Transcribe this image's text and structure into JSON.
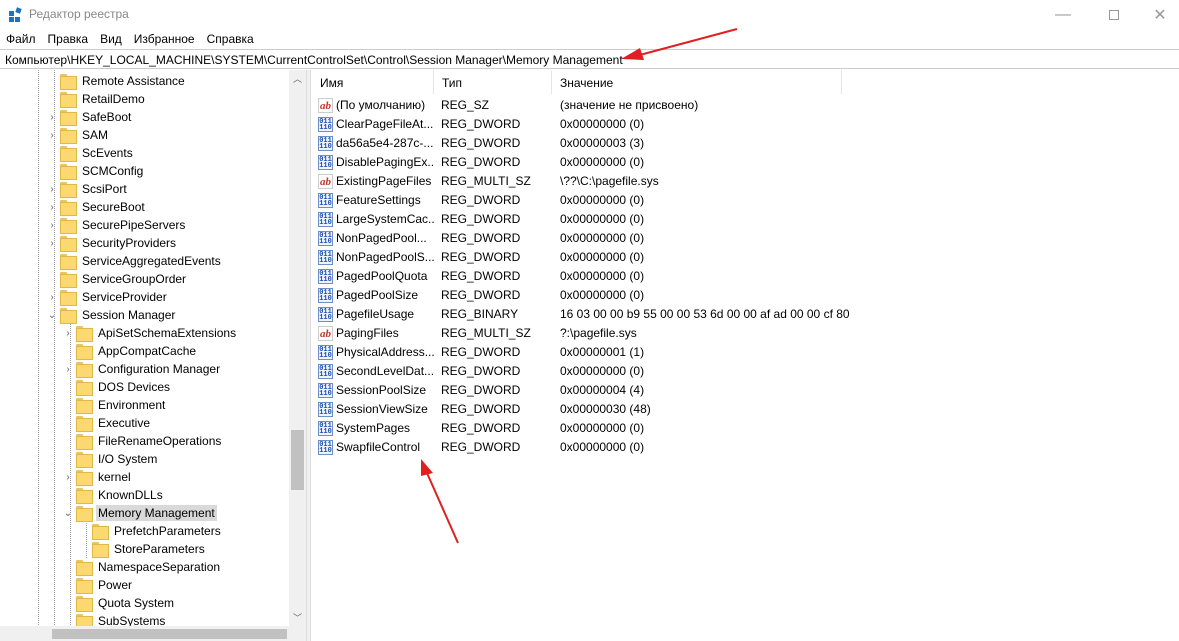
{
  "window": {
    "title": "Редактор реестра",
    "minimize_icon": "minimize-icon",
    "maximize_icon": "maximize-icon",
    "close_icon": "close-icon"
  },
  "menu": [
    "Файл",
    "Правка",
    "Вид",
    "Избранное",
    "Справка"
  ],
  "address": "Компьютер\\HKEY_LOCAL_MACHINE\\SYSTEM\\CurrentControlSet\\Control\\Session Manager\\Memory Management",
  "tree": {
    "items": [
      {
        "label": "Remote Assistance",
        "level": 1,
        "expander": ""
      },
      {
        "label": "RetailDemo",
        "level": 1,
        "expander": ""
      },
      {
        "label": "SafeBoot",
        "level": 1,
        "expander": "›"
      },
      {
        "label": "SAM",
        "level": 1,
        "expander": "›"
      },
      {
        "label": "ScEvents",
        "level": 1,
        "expander": ""
      },
      {
        "label": "SCMConfig",
        "level": 1,
        "expander": ""
      },
      {
        "label": "ScsiPort",
        "level": 1,
        "expander": "›"
      },
      {
        "label": "SecureBoot",
        "level": 1,
        "expander": "›"
      },
      {
        "label": "SecurePipeServers",
        "level": 1,
        "expander": "›"
      },
      {
        "label": "SecurityProviders",
        "level": 1,
        "expander": "›"
      },
      {
        "label": "ServiceAggregatedEvents",
        "level": 1,
        "expander": ""
      },
      {
        "label": "ServiceGroupOrder",
        "level": 1,
        "expander": ""
      },
      {
        "label": "ServiceProvider",
        "level": 1,
        "expander": "›"
      },
      {
        "label": "Session Manager",
        "level": 1,
        "expander": "⌄"
      },
      {
        "label": "ApiSetSchemaExtensions",
        "level": 2,
        "expander": "›"
      },
      {
        "label": "AppCompatCache",
        "level": 2,
        "expander": ""
      },
      {
        "label": "Configuration Manager",
        "level": 2,
        "expander": "›"
      },
      {
        "label": "DOS Devices",
        "level": 2,
        "expander": ""
      },
      {
        "label": "Environment",
        "level": 2,
        "expander": ""
      },
      {
        "label": "Executive",
        "level": 2,
        "expander": ""
      },
      {
        "label": "FileRenameOperations",
        "level": 2,
        "expander": ""
      },
      {
        "label": "I/O System",
        "level": 2,
        "expander": ""
      },
      {
        "label": "kernel",
        "level": 2,
        "expander": "›"
      },
      {
        "label": "KnownDLLs",
        "level": 2,
        "expander": ""
      },
      {
        "label": "Memory Management",
        "level": 2,
        "expander": "⌄",
        "selected": true
      },
      {
        "label": "PrefetchParameters",
        "level": 3,
        "expander": ""
      },
      {
        "label": "StoreParameters",
        "level": 3,
        "expander": ""
      },
      {
        "label": "NamespaceSeparation",
        "level": 2,
        "expander": ""
      },
      {
        "label": "Power",
        "level": 2,
        "expander": ""
      },
      {
        "label": "Quota System",
        "level": 2,
        "expander": ""
      },
      {
        "label": "SubSystems",
        "level": 2,
        "expander": ""
      }
    ]
  },
  "list": {
    "columns": [
      "Имя",
      "Тип",
      "Значение"
    ],
    "rows": [
      {
        "icon": "string-value-icon",
        "name": "(По умолчанию)",
        "type": "REG_SZ",
        "value": "(значение не присвоено)"
      },
      {
        "icon": "binary-value-icon",
        "name": "ClearPageFileAt...",
        "type": "REG_DWORD",
        "value": "0x00000000 (0)"
      },
      {
        "icon": "binary-value-icon",
        "name": "da56a5e4-287c-...",
        "type": "REG_DWORD",
        "value": "0x00000003 (3)"
      },
      {
        "icon": "binary-value-icon",
        "name": "DisablePagingEx...",
        "type": "REG_DWORD",
        "value": "0x00000000 (0)"
      },
      {
        "icon": "string-value-icon",
        "name": "ExistingPageFiles",
        "type": "REG_MULTI_SZ",
        "value": "\\??\\C:\\pagefile.sys"
      },
      {
        "icon": "binary-value-icon",
        "name": "FeatureSettings",
        "type": "REG_DWORD",
        "value": "0x00000000 (0)"
      },
      {
        "icon": "binary-value-icon",
        "name": "LargeSystemCac...",
        "type": "REG_DWORD",
        "value": "0x00000000 (0)"
      },
      {
        "icon": "binary-value-icon",
        "name": "NonPagedPool...",
        "type": "REG_DWORD",
        "value": "0x00000000 (0)"
      },
      {
        "icon": "binary-value-icon",
        "name": "NonPagedPoolS...",
        "type": "REG_DWORD",
        "value": "0x00000000 (0)"
      },
      {
        "icon": "binary-value-icon",
        "name": "PagedPoolQuota",
        "type": "REG_DWORD",
        "value": "0x00000000 (0)"
      },
      {
        "icon": "binary-value-icon",
        "name": "PagedPoolSize",
        "type": "REG_DWORD",
        "value": "0x00000000 (0)"
      },
      {
        "icon": "binary-value-icon",
        "name": "PagefileUsage",
        "type": "REG_BINARY",
        "value": "16 03 00 00 b9 55 00 00 53 6d 00 00 af ad 00 00 cf 80..."
      },
      {
        "icon": "string-value-icon",
        "name": "PagingFiles",
        "type": "REG_MULTI_SZ",
        "value": "?:\\pagefile.sys"
      },
      {
        "icon": "binary-value-icon",
        "name": "PhysicalAddress...",
        "type": "REG_DWORD",
        "value": "0x00000001 (1)"
      },
      {
        "icon": "binary-value-icon",
        "name": "SecondLevelDat...",
        "type": "REG_DWORD",
        "value": "0x00000000 (0)"
      },
      {
        "icon": "binary-value-icon",
        "name": "SessionPoolSize",
        "type": "REG_DWORD",
        "value": "0x00000004 (4)"
      },
      {
        "icon": "binary-value-icon",
        "name": "SessionViewSize",
        "type": "REG_DWORD",
        "value": "0x00000030 (48)"
      },
      {
        "icon": "binary-value-icon",
        "name": "SystemPages",
        "type": "REG_DWORD",
        "value": "0x00000000 (0)"
      },
      {
        "icon": "binary-value-icon",
        "name": "SwapfileControl",
        "type": "REG_DWORD",
        "value": "0x00000000 (0)"
      }
    ]
  },
  "annotations": {
    "arrow_color": "#e02020"
  }
}
